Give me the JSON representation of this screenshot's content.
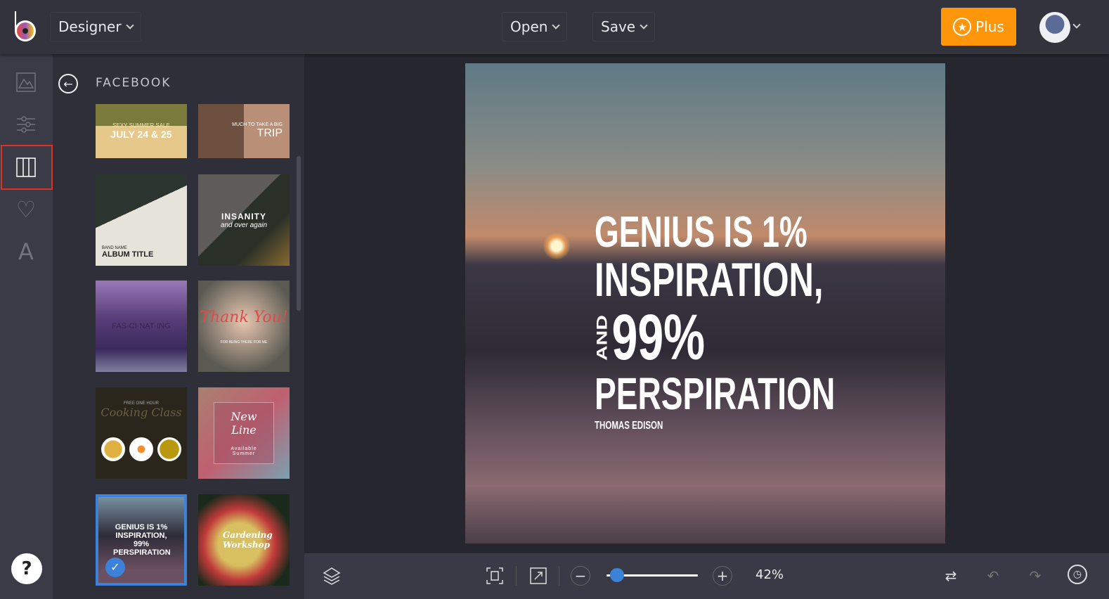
{
  "header": {
    "mode": "Designer",
    "open": "Open",
    "save": "Save",
    "plus": "Plus"
  },
  "sidebar": {
    "icons": [
      "image-icon",
      "adjust-icon",
      "layout-icon",
      "heart-icon",
      "text-icon"
    ],
    "selected": "layout-icon",
    "help": "?"
  },
  "panel": {
    "title": "FACEBOOK",
    "templates": [
      {
        "text": "JULY 24 & 25",
        "sub": "SEXY SUMMER SALE"
      },
      {
        "text": "TRIP",
        "sub": "MUCH TO TAKE A BIG"
      },
      {
        "text": "ALBUM TITLE",
        "sub": "BAND NAME"
      },
      {
        "text": "INSANITY",
        "sub": "and over again"
      },
      {
        "text": "FAS·CI·NAT·ING",
        "sub": ""
      },
      {
        "text": "Thank You!",
        "sub": "FOR BEING THERE FOR ME"
      },
      {
        "text": "Cooking Class",
        "sub": "FREE ONE HOUR"
      },
      {
        "text": "New Line",
        "sub": "Available Summer"
      },
      {
        "text": "GENIUS IS 1% INSPIRATION, 99% PERSPIRATION",
        "sub": ""
      },
      {
        "text": "Gardening Workshop",
        "sub": ""
      }
    ],
    "selected_index": 8
  },
  "canvas": {
    "line1": "GENIUS IS 1%",
    "line2": "INSPIRATION,",
    "and": "AND",
    "line3": "99%",
    "line4": "PERSPIRATION",
    "author": "THOMAS EDISON"
  },
  "bottom": {
    "zoom": "42%",
    "zoom_value": 42
  }
}
